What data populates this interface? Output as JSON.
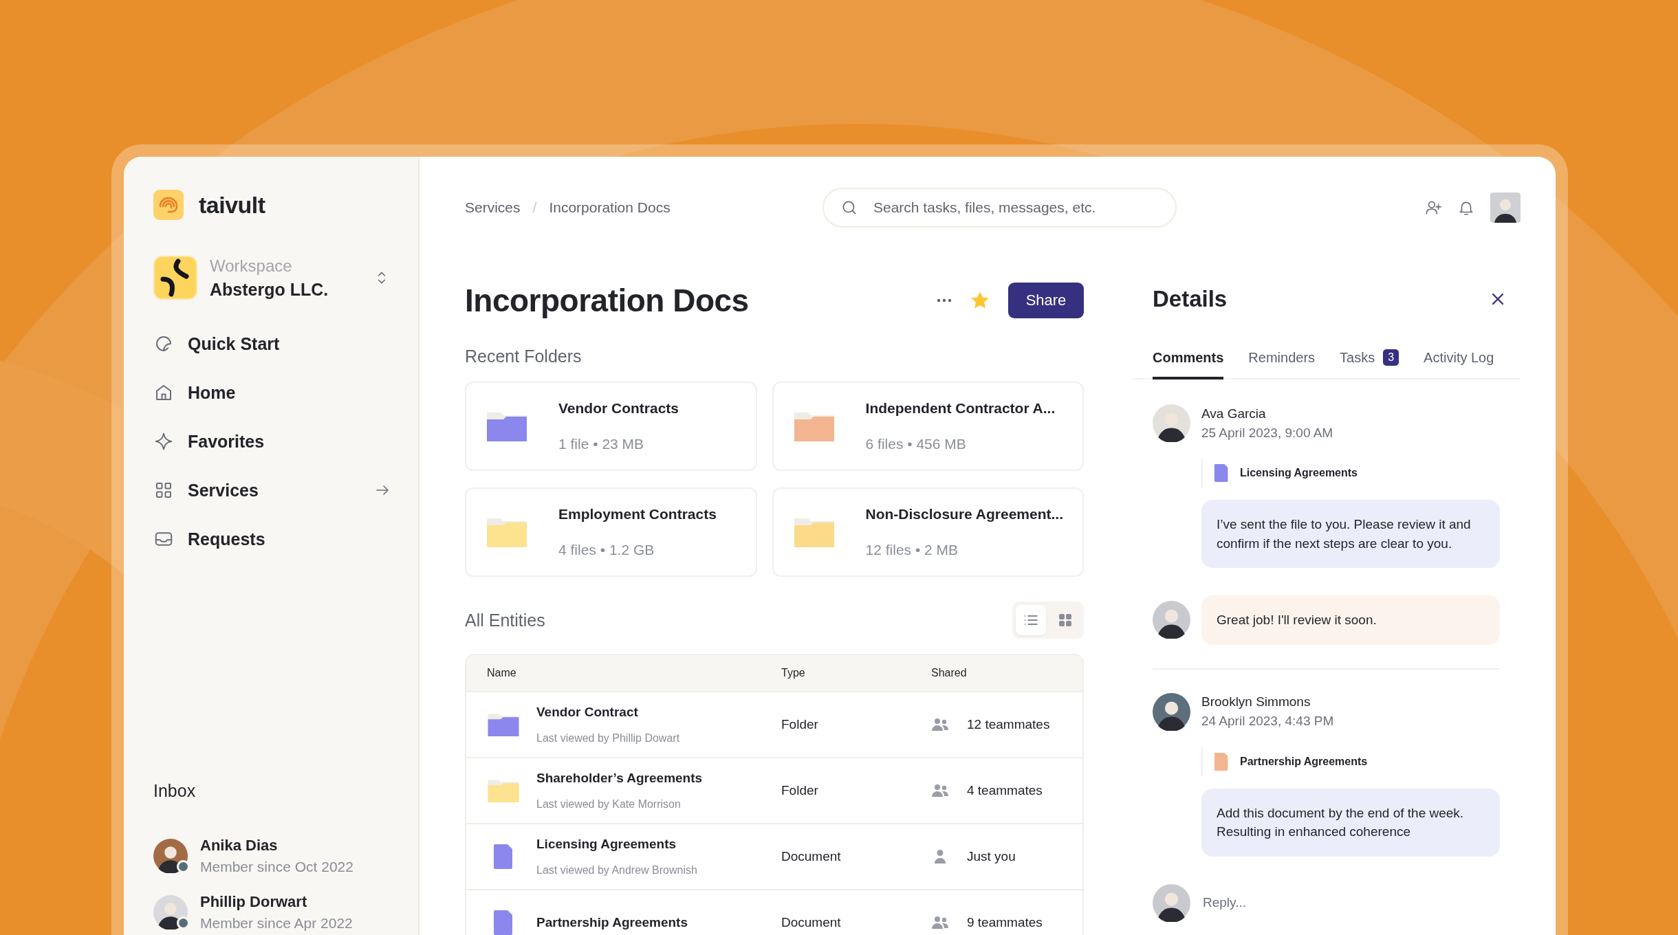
{
  "brand": {
    "name": "taivult"
  },
  "workspace": {
    "label": "Workspace",
    "name": "Abstergo LLC."
  },
  "nav": [
    {
      "label": "Quick Start",
      "has_arrow": false
    },
    {
      "label": "Home",
      "has_arrow": false
    },
    {
      "label": "Favorites",
      "has_arrow": false
    },
    {
      "label": "Services",
      "has_arrow": true
    },
    {
      "label": "Requests",
      "has_arrow": false
    }
  ],
  "inbox": {
    "title": "Inbox",
    "users": [
      {
        "name": "Anika Dias",
        "since": "Member since Oct 2022",
        "online": true
      },
      {
        "name": "Phillip Dorwart",
        "since": "Member since Apr 2022",
        "online": true
      }
    ]
  },
  "breadcrumbs": {
    "items": [
      "Services",
      "Incorporation Docs"
    ],
    "separator": "/"
  },
  "search": {
    "placeholder": "Search tasks, files, messages, etc."
  },
  "page": {
    "title": "Incorporation Docs",
    "favorited": true,
    "share_label": "Share"
  },
  "recent_folders": {
    "title": "Recent Folders",
    "items": [
      {
        "name": "Vendor Contracts",
        "meta": "1 file • 23 MB",
        "color": "#8b87ec"
      },
      {
        "name": "Independent Contractor A...",
        "meta": "6 files • 456 MB",
        "color": "#f3b58f"
      },
      {
        "name": "Employment Contracts",
        "meta": "4 files • 1.2 GB",
        "color": "#fde28f"
      },
      {
        "name": "Non-Disclosure Agreement...",
        "meta": "12 files • 2 MB",
        "color": "#fbda8a"
      }
    ]
  },
  "entities": {
    "title": "All Entities",
    "views": [
      {
        "kind": "list",
        "selected": true
      },
      {
        "kind": "grid",
        "selected": false
      }
    ],
    "columns": [
      "Name",
      "Type",
      "Shared"
    ],
    "rows": [
      {
        "kind": "folder",
        "color": "#8b87ec",
        "name": "Vendor Contract",
        "viewed": "Last viewed by Phillip Dowart",
        "type": "Folder",
        "shared": {
          "kind": "group",
          "text": "12 teammates"
        }
      },
      {
        "kind": "folder",
        "color": "#fde28f",
        "name": "Shareholder’s Agreements",
        "viewed": "Last viewed by Kate Morrison",
        "type": "Folder",
        "shared": {
          "kind": "group",
          "text": "4 teammates"
        }
      },
      {
        "kind": "document",
        "color": "#8b87ec",
        "name": "Licensing Agreements",
        "viewed": "Last viewed by Andrew Brownish",
        "type": "Document",
        "shared": {
          "kind": "single",
          "text": "Just you"
        }
      },
      {
        "kind": "document",
        "color": "#8b87ec",
        "name": "Partnership Agreements",
        "type": "Document",
        "shared": {
          "kind": "group",
          "text": "9 teammates"
        }
      }
    ]
  },
  "details": {
    "title": "Details",
    "tabs": [
      {
        "label": "Comments",
        "selected": true
      },
      {
        "label": "Reminders",
        "selected": false
      },
      {
        "label": "Tasks",
        "selected": false,
        "badge": "3"
      },
      {
        "label": "Activity Log",
        "selected": false
      }
    ],
    "comments": [
      {
        "kind": "comment",
        "author": "Ava Garcia",
        "time": "25 April 2023, 9:00 AM",
        "attachment": {
          "name": "Licensing Agreements",
          "color": "#8b87ec"
        },
        "message": "I’ve sent the file to you. Please review it and confirm if the next steps are clear to you."
      },
      {
        "kind": "reply",
        "message": "Great job! I'll review it soon."
      },
      {
        "kind": "comment",
        "author": "Brooklyn Simmons",
        "time": "24 April 2023, 4:43 PM",
        "attachment": {
          "name": "Partnership Agreements",
          "color": "#f3b58f"
        },
        "message": "Add this document by the end of the week. Resulting in enhanced coherence"
      }
    ],
    "reply": {
      "placeholder": "Reply..."
    }
  }
}
